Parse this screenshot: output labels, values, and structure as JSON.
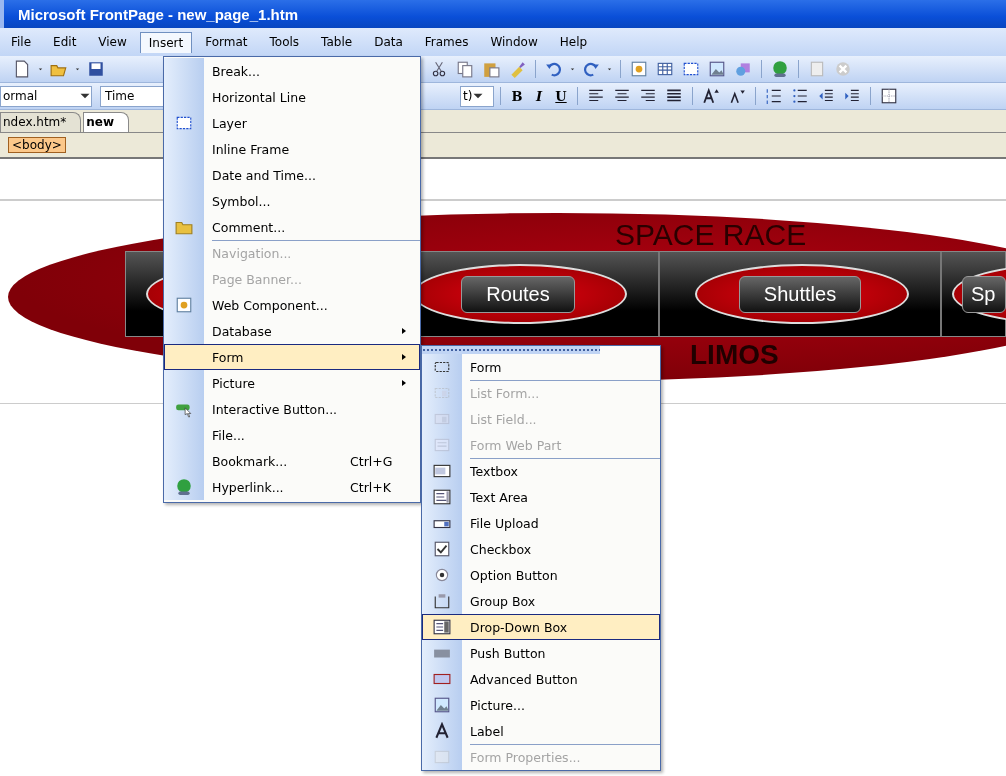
{
  "window": {
    "title": "Microsoft FrontPage - new_page_1.htm"
  },
  "menu_bar": [
    {
      "label": "File",
      "selected": false
    },
    {
      "label": "Edit",
      "selected": false
    },
    {
      "label": "View",
      "selected": false
    },
    {
      "label": "Insert",
      "selected": true
    },
    {
      "label": "Format",
      "selected": false
    },
    {
      "label": "Tools",
      "selected": false
    },
    {
      "label": "Table",
      "selected": false
    },
    {
      "label": "Data",
      "selected": false
    },
    {
      "label": "Frames",
      "selected": false
    },
    {
      "label": "Window",
      "selected": false
    },
    {
      "label": "Help",
      "selected": false
    }
  ],
  "formatting_toolbar": {
    "style_box": "ormal",
    "font_box": "Time",
    "size_box": "t)",
    "bold": "B",
    "italic": "I",
    "underline": "U"
  },
  "document_tabs": [
    {
      "label": "ndex.htm*",
      "selected": false
    },
    {
      "label": "new",
      "selected": true
    }
  ],
  "quick_tag": "<body>",
  "banner": {
    "title": "SPACE RACE",
    "subtitle": "LIMOS",
    "nav_buttons": [
      "Routes",
      "Shuttles",
      "Sp"
    ]
  },
  "insert_menu": [
    {
      "label": "Break...",
      "disabled": false,
      "submenu": false,
      "selected": false,
      "divider_above": false
    },
    {
      "label": "Horizontal Line",
      "disabled": false,
      "submenu": false,
      "selected": false,
      "divider_above": false
    },
    {
      "label": "Layer",
      "disabled": false,
      "submenu": false,
      "selected": false,
      "divider_above": false
    },
    {
      "label": "Inline Frame",
      "disabled": false,
      "submenu": false,
      "selected": false,
      "divider_above": false
    },
    {
      "label": "Date and Time...",
      "disabled": false,
      "submenu": false,
      "selected": false,
      "divider_above": false
    },
    {
      "label": "Symbol...",
      "disabled": false,
      "submenu": false,
      "selected": false,
      "divider_above": false
    },
    {
      "label": "Comment...",
      "disabled": false,
      "submenu": false,
      "selected": false,
      "divider_above": false
    },
    {
      "label": "Navigation...",
      "disabled": true,
      "submenu": false,
      "selected": false,
      "divider_above": true
    },
    {
      "label": "Page Banner...",
      "disabled": true,
      "submenu": false,
      "selected": false,
      "divider_above": false
    },
    {
      "label": "Web Component...",
      "disabled": false,
      "submenu": false,
      "selected": false,
      "divider_above": false
    },
    {
      "label": "Database",
      "disabled": false,
      "submenu": true,
      "selected": false,
      "divider_above": false
    },
    {
      "label": "Form",
      "disabled": false,
      "submenu": true,
      "selected": true,
      "divider_above": false
    },
    {
      "label": "Picture",
      "disabled": false,
      "submenu": true,
      "selected": false,
      "divider_above": false
    },
    {
      "label": "Interactive Button...",
      "disabled": false,
      "submenu": false,
      "selected": false,
      "divider_above": false
    },
    {
      "label": "File...",
      "disabled": false,
      "submenu": false,
      "selected": false,
      "divider_above": false
    },
    {
      "label": "Bookmark...",
      "shortcut": "Ctrl+G",
      "disabled": false,
      "submenu": false,
      "selected": false,
      "divider_above": false
    },
    {
      "label": "Hyperlink...",
      "shortcut": "Ctrl+K",
      "disabled": false,
      "submenu": false,
      "selected": false,
      "divider_above": false
    }
  ],
  "form_submenu": [
    {
      "label": "Form",
      "disabled": false,
      "selected": false,
      "divider_above": false
    },
    {
      "label": "List Form...",
      "disabled": true,
      "selected": false,
      "divider_above": true
    },
    {
      "label": "List Field...",
      "disabled": true,
      "selected": false,
      "divider_above": false
    },
    {
      "label": "Form Web Part",
      "disabled": true,
      "selected": false,
      "divider_above": false
    },
    {
      "label": "Textbox",
      "disabled": false,
      "selected": false,
      "divider_above": true
    },
    {
      "label": "Text Area",
      "disabled": false,
      "selected": false,
      "divider_above": false
    },
    {
      "label": "File Upload",
      "disabled": false,
      "selected": false,
      "divider_above": false
    },
    {
      "label": "Checkbox",
      "disabled": false,
      "selected": false,
      "divider_above": false
    },
    {
      "label": "Option Button",
      "disabled": false,
      "selected": false,
      "divider_above": false
    },
    {
      "label": "Group Box",
      "disabled": false,
      "selected": false,
      "divider_above": false
    },
    {
      "label": "Drop-Down Box",
      "disabled": false,
      "selected": true,
      "divider_above": false
    },
    {
      "label": "Push Button",
      "disabled": false,
      "selected": false,
      "divider_above": false
    },
    {
      "label": "Advanced Button",
      "disabled": false,
      "selected": false,
      "divider_above": false
    },
    {
      "label": "Picture...",
      "disabled": false,
      "selected": false,
      "divider_above": false
    },
    {
      "label": "Label",
      "disabled": false,
      "selected": false,
      "divider_above": false
    },
    {
      "label": "Form Properties...",
      "disabled": true,
      "selected": false,
      "divider_above": true
    }
  ]
}
